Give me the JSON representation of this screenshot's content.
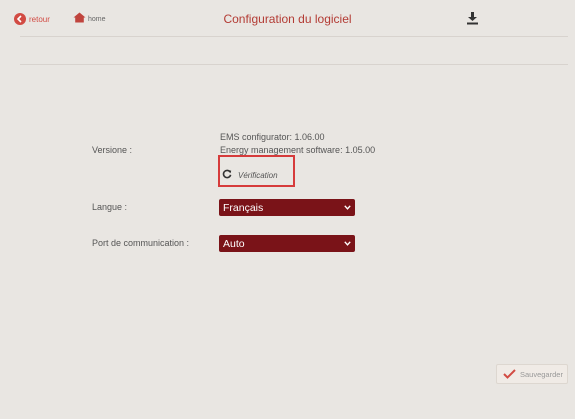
{
  "header": {
    "back_label": "retour",
    "home_label": "home",
    "title": "Configuration du logiciel"
  },
  "version": {
    "label": "Versione :",
    "configurator": "EMS configurator: 1.06.00",
    "software": "Energy management software: 1.05.00",
    "check_label": "Vérification"
  },
  "language": {
    "label": "Langue :",
    "selected": "Français"
  },
  "port": {
    "label": "Port de communication :",
    "selected": "Auto"
  },
  "footer": {
    "save_label": "Sauvegarder"
  },
  "colors": {
    "accent": "#b33b34",
    "select_bg": "#7a1318",
    "highlight_box": "#d63b3b",
    "background": "#e9e6e2"
  },
  "icons": {
    "back": "arrow-left-circle-icon",
    "home": "home-icon",
    "download": "download-icon",
    "refresh": "refresh-icon",
    "chevron": "chevron-down-icon",
    "check": "check-icon"
  }
}
